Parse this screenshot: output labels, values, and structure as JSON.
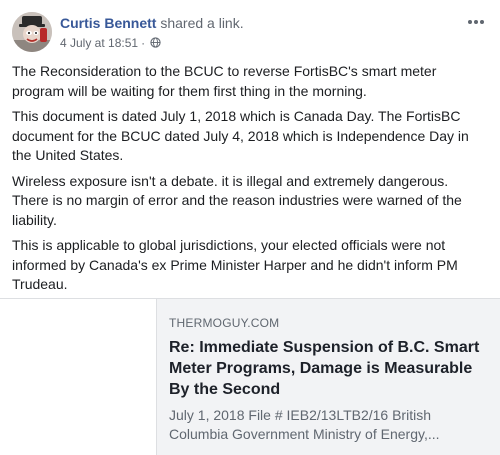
{
  "post": {
    "author": "Curtis Bennett",
    "action": "shared a link.",
    "date": "4 July at 18:51",
    "privacy_icon": "globe-icon",
    "more_icon": "more-options-icon",
    "paragraphs": [
      "The Reconsideration to the BCUC to reverse FortisBC's smart meter program will be waiting for them first thing in the morning.",
      "This document is dated July 1, 2018 which is Canada Day. The FortisBC document for the BCUC dated July 4, 2018 which is Independence Day in the United States.",
      "Wireless exposure isn't a debate. it is illegal and extremely dangerous. There is no margin of error and the reason industries were warned of the liability.",
      "This is applicable to global jurisdictions, your elected officials were not informed by Canada's ex Prime Minister Harper and he didn't inform PM Trudeau."
    ]
  },
  "link": {
    "domain": "THERMOGUY.COM",
    "title": "Re: Immediate Suspension of B.C. Smart Meter Programs, Damage is Measurable By the Second",
    "description": "July 1, 2018 File # IEB2/13LTB2/16 British Columbia Government Ministry of Energy,..."
  },
  "colors": {
    "author": "#385898",
    "secondary_text": "#616770",
    "body_text": "#1c1e21",
    "link_background": "#f2f3f5"
  }
}
